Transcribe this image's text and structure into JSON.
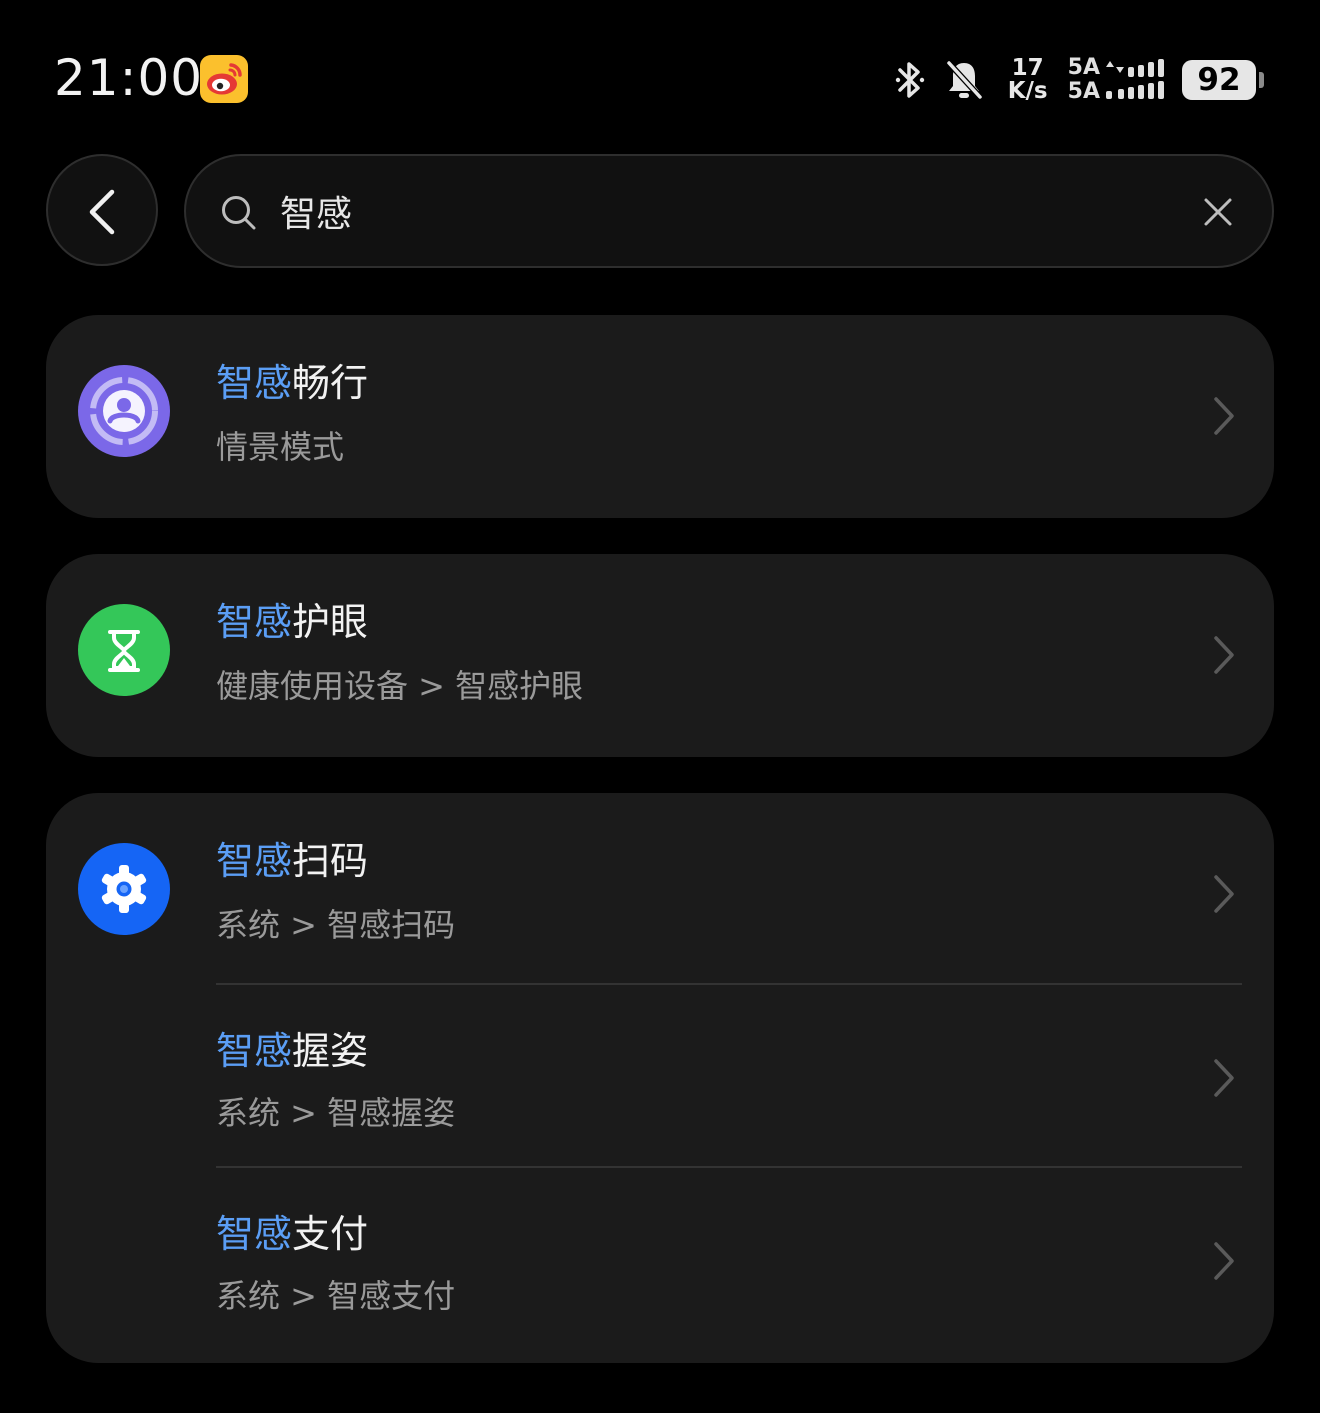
{
  "status_bar": {
    "time": "21:00",
    "notification_app_icon": "weibo-icon",
    "bluetooth_icon": "bluetooth-icon",
    "mute_icon": "bell-off-icon",
    "net_speed_value": "17",
    "net_speed_unit": "K/s",
    "sim1_label": "5A",
    "sim2_label": "5A",
    "battery_level": "92"
  },
  "search": {
    "back_icon": "chevron-left-icon",
    "search_icon": "search-icon",
    "query": "智感",
    "clear_icon": "close-icon"
  },
  "results": [
    {
      "highlight": "智感",
      "rest": "畅行",
      "subtitle": "情景模式",
      "icon": "scene-mode-icon",
      "icon_color": "#7b68e8"
    },
    {
      "highlight": "智感",
      "rest": "护眼",
      "subtitle": "健康使用设备 > 智感护眼",
      "icon": "hourglass-icon",
      "icon_color": "#34c759"
    },
    {
      "highlight": "智感",
      "rest": "扫码",
      "subtitle": "系统 > 智感扫码",
      "icon": "settings-gear-icon",
      "icon_color": "#1565f5"
    },
    {
      "highlight": "智感",
      "rest": "握姿",
      "subtitle": "系统 > 智感握姿"
    },
    {
      "highlight": "智感",
      "rest": "支付",
      "subtitle": "系统 > 智感支付"
    }
  ],
  "colors": {
    "highlight": "#5b9ef5",
    "card_bg": "#1b1b1b",
    "subtitle": "#9a9a9a"
  }
}
